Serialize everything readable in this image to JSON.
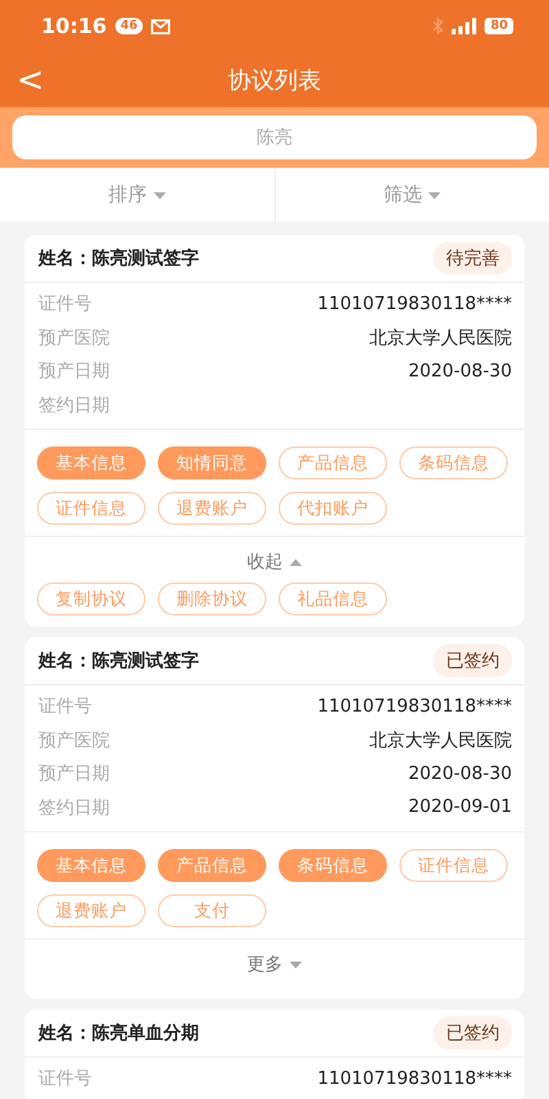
{
  "status_bar": {
    "time": "10:16",
    "badge": "46",
    "battery": "80"
  },
  "nav": {
    "title": "协议列表",
    "back": "<"
  },
  "search": {
    "placeholder": "陈亮"
  },
  "sort_bar": [
    {
      "label": "排序"
    },
    {
      "label": "筛选"
    }
  ],
  "cards": [
    {
      "name": "姓名：陈亮测试签字",
      "status": "待完善",
      "fields": [
        {
          "label": "证件号",
          "value": "11010719830118****"
        },
        {
          "label": "预产医院",
          "value": "北京大学人民医院"
        },
        {
          "label": "预产日期",
          "value": "2020-08-30"
        },
        {
          "label": "签约日期"
        }
      ],
      "tags": [
        {
          "label": "基本信息",
          "filled": true
        },
        {
          "label": "知情同意",
          "filled": true
        },
        {
          "label": "产品信息",
          "filled": false
        },
        {
          "label": "条码信息",
          "filled": false
        },
        {
          "label": "证件信息",
          "filled": false
        },
        {
          "label": "退费账户",
          "filled": false
        },
        {
          "label": "代扣账户",
          "filled": false
        }
      ],
      "toggle": {
        "label": "收起",
        "expanded": true
      },
      "extra_tags": [
        {
          "label": "复制协议",
          "filled": false
        },
        {
          "label": "删除协议",
          "filled": false
        },
        {
          "label": "礼品信息",
          "filled": false
        }
      ]
    },
    {
      "name": "姓名：陈亮测试签字",
      "status": "已签约",
      "fields": [
        {
          "label": "证件号",
          "value": "11010719830118****"
        },
        {
          "label": "预产医院",
          "value": "北京大学人民医院"
        },
        {
          "label": "预产日期",
          "value": "2020-08-30"
        },
        {
          "label": "签约日期",
          "value": "2020-09-01"
        }
      ],
      "tags": [
        {
          "label": "基本信息",
          "filled": true
        },
        {
          "label": "产品信息",
          "filled": true
        },
        {
          "label": "条码信息",
          "filled": true
        },
        {
          "label": "证件信息",
          "filled": false
        },
        {
          "label": "退费账户",
          "filled": false
        },
        {
          "label": "支付",
          "filled": false
        }
      ],
      "toggle": {
        "label": "更多",
        "expanded": false
      }
    },
    {
      "name": "姓名：陈亮单血分期",
      "status": "已签约",
      "fields": [
        {
          "label": "证件号",
          "value": "11010719830118****"
        }
      ]
    }
  ]
}
